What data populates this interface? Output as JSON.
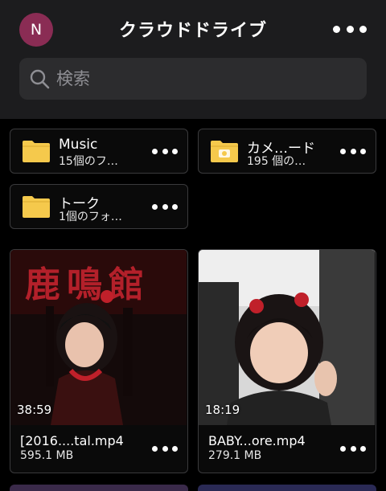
{
  "header": {
    "avatar_letter": "N",
    "title": "クラウドドライブ",
    "more_icon": "more-horizontal-icon"
  },
  "search": {
    "placeholder": "検索",
    "icon": "search-icon"
  },
  "folders": [
    {
      "name": "Music",
      "subtitle": "15個のフ…",
      "icon": "folder-icon"
    },
    {
      "name": "カメ…ード",
      "subtitle": "195 個の…",
      "icon": "camera-folder-icon"
    },
    {
      "name": "トーク",
      "subtitle": "1個のフォ…",
      "icon": "folder-icon"
    }
  ],
  "files": [
    {
      "name": "[2016....tal.mp4",
      "size": "595.1 MB",
      "duration": "38:59"
    },
    {
      "name": "BABY...ore.mp4",
      "size": "279.1 MB",
      "duration": "18:19"
    }
  ],
  "colors": {
    "background": "#000000",
    "header": "#1c1c1e",
    "avatar": "#8a2c54",
    "folder": "#f5c94c",
    "card_border": "#3a3a3c"
  }
}
